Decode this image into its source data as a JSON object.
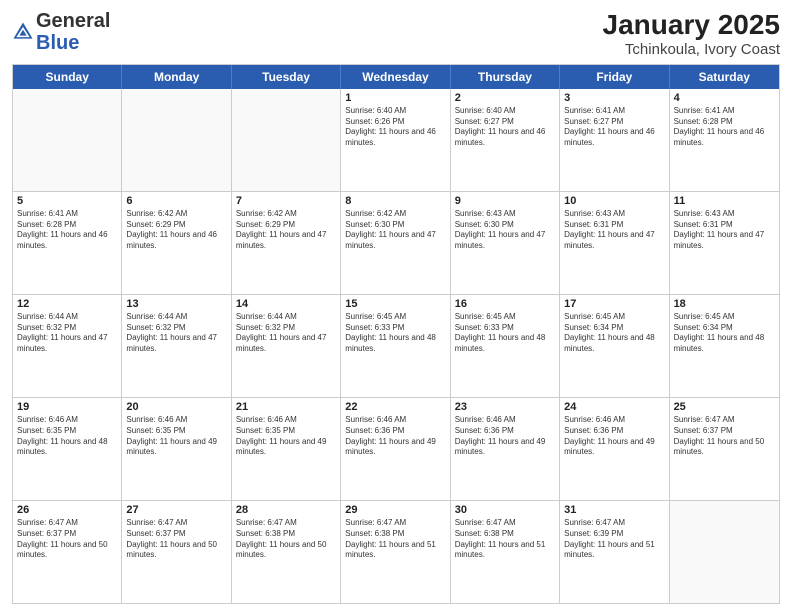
{
  "logo": {
    "general": "General",
    "blue": "Blue"
  },
  "title": "January 2025",
  "subtitle": "Tchinkoula, Ivory Coast",
  "header_days": [
    "Sunday",
    "Monday",
    "Tuesday",
    "Wednesday",
    "Thursday",
    "Friday",
    "Saturday"
  ],
  "weeks": [
    [
      {
        "day": "",
        "sunrise": "",
        "sunset": "",
        "daylight": ""
      },
      {
        "day": "",
        "sunrise": "",
        "sunset": "",
        "daylight": ""
      },
      {
        "day": "",
        "sunrise": "",
        "sunset": "",
        "daylight": ""
      },
      {
        "day": "1",
        "sunrise": "Sunrise: 6:40 AM",
        "sunset": "Sunset: 6:26 PM",
        "daylight": "Daylight: 11 hours and 46 minutes."
      },
      {
        "day": "2",
        "sunrise": "Sunrise: 6:40 AM",
        "sunset": "Sunset: 6:27 PM",
        "daylight": "Daylight: 11 hours and 46 minutes."
      },
      {
        "day": "3",
        "sunrise": "Sunrise: 6:41 AM",
        "sunset": "Sunset: 6:27 PM",
        "daylight": "Daylight: 11 hours and 46 minutes."
      },
      {
        "day": "4",
        "sunrise": "Sunrise: 6:41 AM",
        "sunset": "Sunset: 6:28 PM",
        "daylight": "Daylight: 11 hours and 46 minutes."
      }
    ],
    [
      {
        "day": "5",
        "sunrise": "Sunrise: 6:41 AM",
        "sunset": "Sunset: 6:28 PM",
        "daylight": "Daylight: 11 hours and 46 minutes."
      },
      {
        "day": "6",
        "sunrise": "Sunrise: 6:42 AM",
        "sunset": "Sunset: 6:29 PM",
        "daylight": "Daylight: 11 hours and 46 minutes."
      },
      {
        "day": "7",
        "sunrise": "Sunrise: 6:42 AM",
        "sunset": "Sunset: 6:29 PM",
        "daylight": "Daylight: 11 hours and 47 minutes."
      },
      {
        "day": "8",
        "sunrise": "Sunrise: 6:42 AM",
        "sunset": "Sunset: 6:30 PM",
        "daylight": "Daylight: 11 hours and 47 minutes."
      },
      {
        "day": "9",
        "sunrise": "Sunrise: 6:43 AM",
        "sunset": "Sunset: 6:30 PM",
        "daylight": "Daylight: 11 hours and 47 minutes."
      },
      {
        "day": "10",
        "sunrise": "Sunrise: 6:43 AM",
        "sunset": "Sunset: 6:31 PM",
        "daylight": "Daylight: 11 hours and 47 minutes."
      },
      {
        "day": "11",
        "sunrise": "Sunrise: 6:43 AM",
        "sunset": "Sunset: 6:31 PM",
        "daylight": "Daylight: 11 hours and 47 minutes."
      }
    ],
    [
      {
        "day": "12",
        "sunrise": "Sunrise: 6:44 AM",
        "sunset": "Sunset: 6:32 PM",
        "daylight": "Daylight: 11 hours and 47 minutes."
      },
      {
        "day": "13",
        "sunrise": "Sunrise: 6:44 AM",
        "sunset": "Sunset: 6:32 PM",
        "daylight": "Daylight: 11 hours and 47 minutes."
      },
      {
        "day": "14",
        "sunrise": "Sunrise: 6:44 AM",
        "sunset": "Sunset: 6:32 PM",
        "daylight": "Daylight: 11 hours and 47 minutes."
      },
      {
        "day": "15",
        "sunrise": "Sunrise: 6:45 AM",
        "sunset": "Sunset: 6:33 PM",
        "daylight": "Daylight: 11 hours and 48 minutes."
      },
      {
        "day": "16",
        "sunrise": "Sunrise: 6:45 AM",
        "sunset": "Sunset: 6:33 PM",
        "daylight": "Daylight: 11 hours and 48 minutes."
      },
      {
        "day": "17",
        "sunrise": "Sunrise: 6:45 AM",
        "sunset": "Sunset: 6:34 PM",
        "daylight": "Daylight: 11 hours and 48 minutes."
      },
      {
        "day": "18",
        "sunrise": "Sunrise: 6:45 AM",
        "sunset": "Sunset: 6:34 PM",
        "daylight": "Daylight: 11 hours and 48 minutes."
      }
    ],
    [
      {
        "day": "19",
        "sunrise": "Sunrise: 6:46 AM",
        "sunset": "Sunset: 6:35 PM",
        "daylight": "Daylight: 11 hours and 48 minutes."
      },
      {
        "day": "20",
        "sunrise": "Sunrise: 6:46 AM",
        "sunset": "Sunset: 6:35 PM",
        "daylight": "Daylight: 11 hours and 49 minutes."
      },
      {
        "day": "21",
        "sunrise": "Sunrise: 6:46 AM",
        "sunset": "Sunset: 6:35 PM",
        "daylight": "Daylight: 11 hours and 49 minutes."
      },
      {
        "day": "22",
        "sunrise": "Sunrise: 6:46 AM",
        "sunset": "Sunset: 6:36 PM",
        "daylight": "Daylight: 11 hours and 49 minutes."
      },
      {
        "day": "23",
        "sunrise": "Sunrise: 6:46 AM",
        "sunset": "Sunset: 6:36 PM",
        "daylight": "Daylight: 11 hours and 49 minutes."
      },
      {
        "day": "24",
        "sunrise": "Sunrise: 6:46 AM",
        "sunset": "Sunset: 6:36 PM",
        "daylight": "Daylight: 11 hours and 49 minutes."
      },
      {
        "day": "25",
        "sunrise": "Sunrise: 6:47 AM",
        "sunset": "Sunset: 6:37 PM",
        "daylight": "Daylight: 11 hours and 50 minutes."
      }
    ],
    [
      {
        "day": "26",
        "sunrise": "Sunrise: 6:47 AM",
        "sunset": "Sunset: 6:37 PM",
        "daylight": "Daylight: 11 hours and 50 minutes."
      },
      {
        "day": "27",
        "sunrise": "Sunrise: 6:47 AM",
        "sunset": "Sunset: 6:37 PM",
        "daylight": "Daylight: 11 hours and 50 minutes."
      },
      {
        "day": "28",
        "sunrise": "Sunrise: 6:47 AM",
        "sunset": "Sunset: 6:38 PM",
        "daylight": "Daylight: 11 hours and 50 minutes."
      },
      {
        "day": "29",
        "sunrise": "Sunrise: 6:47 AM",
        "sunset": "Sunset: 6:38 PM",
        "daylight": "Daylight: 11 hours and 51 minutes."
      },
      {
        "day": "30",
        "sunrise": "Sunrise: 6:47 AM",
        "sunset": "Sunset: 6:38 PM",
        "daylight": "Daylight: 11 hours and 51 minutes."
      },
      {
        "day": "31",
        "sunrise": "Sunrise: 6:47 AM",
        "sunset": "Sunset: 6:39 PM",
        "daylight": "Daylight: 11 hours and 51 minutes."
      },
      {
        "day": "",
        "sunrise": "",
        "sunset": "",
        "daylight": ""
      }
    ]
  ]
}
